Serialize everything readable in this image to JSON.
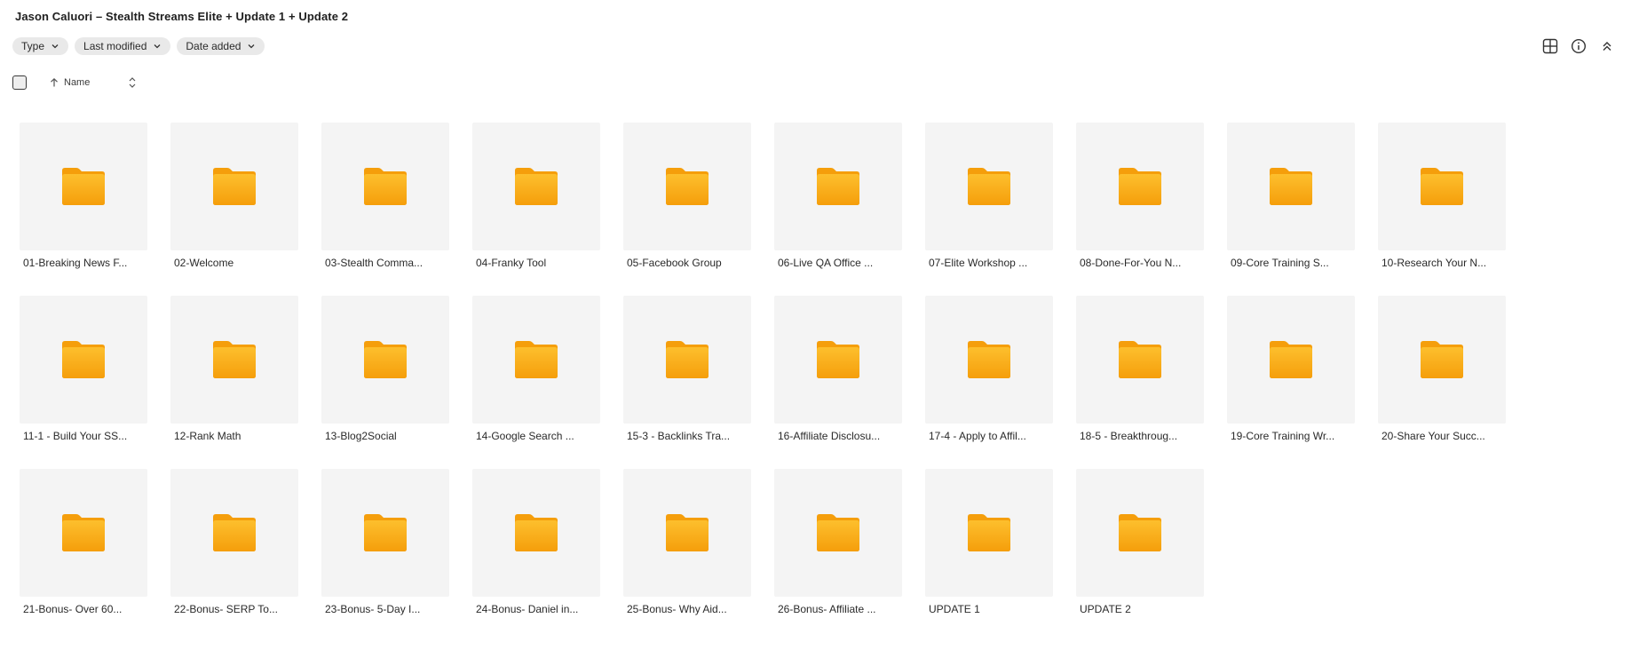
{
  "header": {
    "title": "Jason Caluori – Stealth Streams Elite + Update 1 + Update 2"
  },
  "filters": [
    {
      "label": "Type"
    },
    {
      "label": "Last modified"
    },
    {
      "label": "Date added"
    }
  ],
  "toolbar": {
    "icons": [
      "grid-view-icon",
      "info-icon",
      "collapse-icon"
    ]
  },
  "sort": {
    "label": "Name",
    "direction": "ascending"
  },
  "colors": {
    "folder_top": "#FDBF2D",
    "folder_bottom": "#F59E0B",
    "tile_bg": "#f4f4f4",
    "chip_bg": "#e9e9e9"
  },
  "folders": [
    {
      "name": "01-Breaking News F..."
    },
    {
      "name": "02-Welcome"
    },
    {
      "name": "03-Stealth Comma..."
    },
    {
      "name": "04-Franky Tool"
    },
    {
      "name": "05-Facebook Group"
    },
    {
      "name": "06-Live QA Office ..."
    },
    {
      "name": "07-Elite Workshop ..."
    },
    {
      "name": "08-Done-For-You N..."
    },
    {
      "name": "09-Core Training S..."
    },
    {
      "name": "10-Research Your N..."
    },
    {
      "name": "11-1 - Build Your SS..."
    },
    {
      "name": "12-Rank Math"
    },
    {
      "name": "13-Blog2Social"
    },
    {
      "name": "14-Google Search ..."
    },
    {
      "name": "15-3 - Backlinks Tra..."
    },
    {
      "name": "16-Affiliate Disclosu..."
    },
    {
      "name": "17-4 - Apply to Affil..."
    },
    {
      "name": "18-5 - Breakthroug..."
    },
    {
      "name": "19-Core Training Wr..."
    },
    {
      "name": "20-Share Your Succ..."
    },
    {
      "name": "21-Bonus- Over 60..."
    },
    {
      "name": "22-Bonus- SERP To..."
    },
    {
      "name": "23-Bonus- 5-Day I..."
    },
    {
      "name": "24-Bonus- Daniel in..."
    },
    {
      "name": "25-Bonus- Why Aid..."
    },
    {
      "name": "26-Bonus- Affiliate ..."
    },
    {
      "name": "UPDATE 1"
    },
    {
      "name": "UPDATE 2"
    }
  ]
}
